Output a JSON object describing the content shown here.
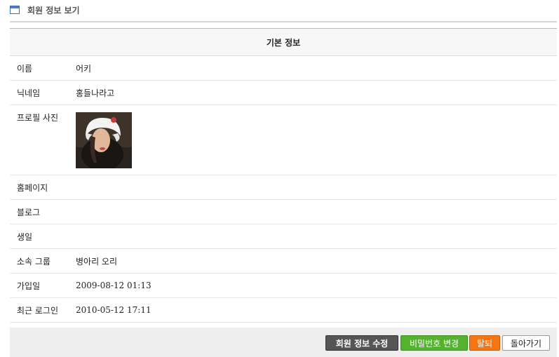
{
  "header": {
    "title": "회원 정보 보기"
  },
  "section": {
    "title": "기본 정보"
  },
  "fields": [
    {
      "label": "이름",
      "value": "어키"
    },
    {
      "label": "닉네임",
      "value": "홍들나라고"
    },
    {
      "label": "프로필 사진",
      "value": ""
    },
    {
      "label": "홈페이지",
      "value": ""
    },
    {
      "label": "블로그",
      "value": ""
    },
    {
      "label": "생일",
      "value": ""
    },
    {
      "label": "소속 그룹",
      "value": "병아리 오리"
    },
    {
      "label": "가입일",
      "value": "2009-08-12 01:13"
    },
    {
      "label": "최근 로그인",
      "value": "2010-05-12 17:11"
    }
  ],
  "actions": {
    "edit": "회원 정보 수정",
    "change_password": "비밀번호 변경",
    "withdraw": "탈퇴",
    "back": "돌아가기"
  }
}
